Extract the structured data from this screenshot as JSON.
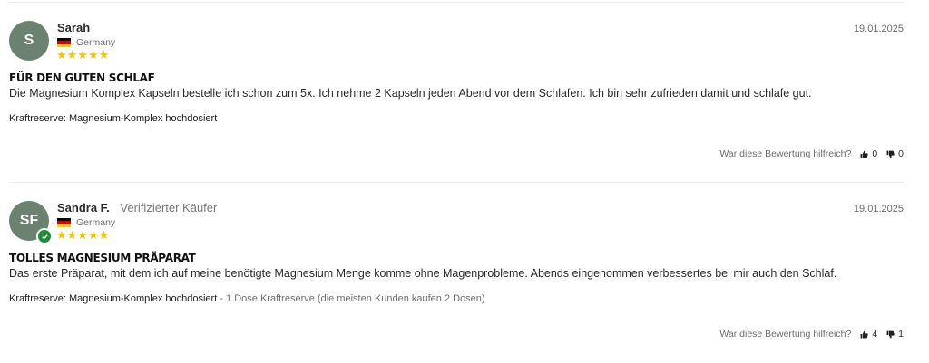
{
  "reviews": [
    {
      "initials": "S",
      "name": "Sarah",
      "verified_label": "",
      "verified": false,
      "country": "Germany",
      "rating": "★★★★★",
      "date": "19.01.2025",
      "title": "FÜR DEN GUTEN SCHLAF",
      "body": "Die Magnesium Komplex Kapseln bestelle ich schon zum 5x. Ich nehme 2 Kapseln jeden Abend vor dem Schlafen. Ich bin sehr zufrieden damit und schlafe gut.",
      "variant": "Kraftreserve: Magnesium-Komplex hochdosiert",
      "variant_extra": "",
      "helpful_label": "War diese Bewertung hilfreich?",
      "up_count": "0",
      "down_count": "0"
    },
    {
      "initials": "SF",
      "name": "Sandra F.",
      "verified_label": "Verifizierter Käufer",
      "verified": true,
      "country": "Germany",
      "rating": "★★★★★",
      "date": "19.01.2025",
      "title": "TOLLES MAGNESIUM PRÄPARAT",
      "body": "Das erste Präparat, mit dem ich auf meine benötigte Magnesium Menge komme ohne Magenprobleme. Abends eingenommen verbessertes bei mir auch den Schlaf.",
      "variant": "Kraftreserve: Magnesium-Komplex hochdosiert",
      "variant_extra": " - 1 Dose Kraftreserve (die meisten Kunden kaufen 2 Dosen)",
      "helpful_label": "War diese Bewertung hilfreich?",
      "up_count": "4",
      "down_count": "1"
    }
  ],
  "colors": {
    "avatar_bg": "#6b8270",
    "star": "#f5c400",
    "verified_badge": "#1f8a3a"
  }
}
